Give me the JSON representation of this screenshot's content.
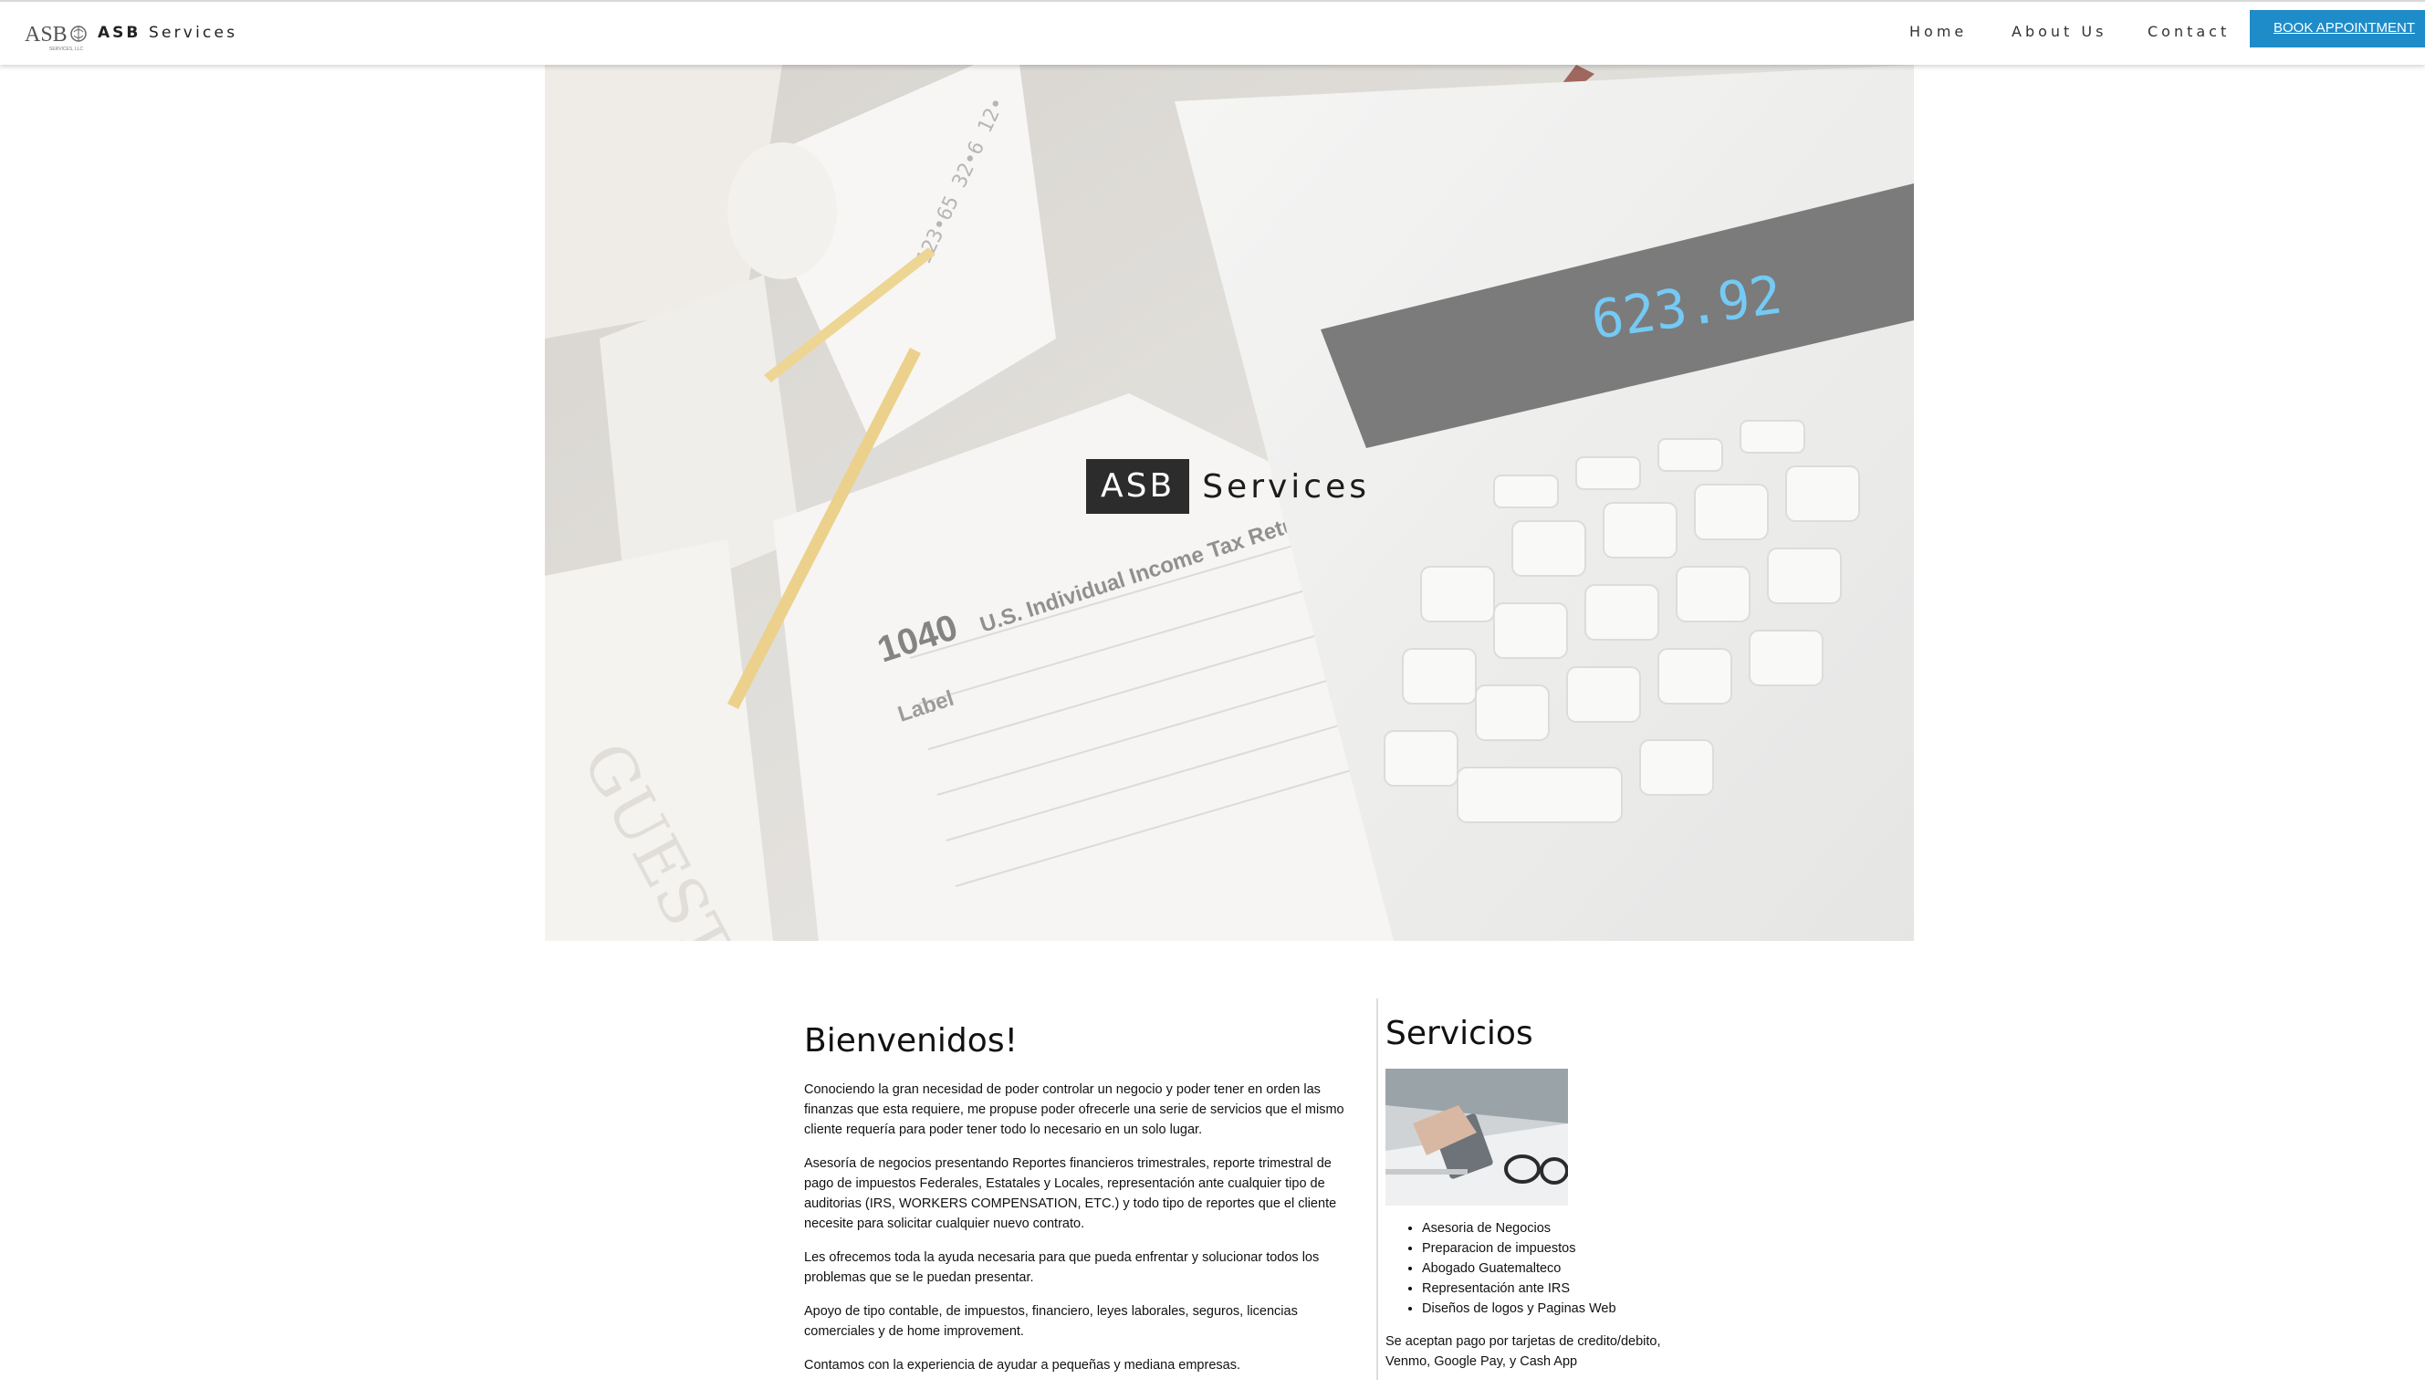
{
  "header": {
    "logo_text": "ASB",
    "logo_subtext": "SERVICES, LLC",
    "brand_bold": "ASB",
    "brand_rest": "Services",
    "nav": {
      "home": "Home",
      "about": "About Us",
      "contact": "Contact"
    },
    "book_button": "BOOK APPOINTMENT"
  },
  "hero": {
    "title_boxed": "ASB",
    "title_rest": "Services",
    "calculator_display": "623.92"
  },
  "welcome": {
    "title": "Bienvenidos!",
    "paragraphs": [
      "Conociendo la gran necesidad de poder controlar un negocio y poder tener en orden las finanzas que esta requiere, me propuse poder ofrecerle una serie de servicios que el mismo cliente requería para poder tener todo lo necesario en un solo lugar.",
      "Asesoría de negocios presentando Reportes financieros trimestrales, reporte trimestral de pago de impuestos Federales, Estatales y Locales, representación ante cualquier tipo de auditorias (IRS, WORKERS COMPENSATION, ETC.) y todo tipo de reportes que el cliente necesite para solicitar cualquier nuevo contrato.",
      "Les ofrecemos toda la ayuda necesaria para que pueda enfrentar y solucionar todos los problemas que se le puedan presentar.",
      "Apoyo de tipo contable, de impuestos, financiero, leyes laborales, seguros, licencias comerciales y de home improvement.",
      "Contamos con la experiencia de ayudar a pequeñas y mediana empresas."
    ]
  },
  "services": {
    "title": "Servicios",
    "items": [
      "Asesoria de Negocios",
      "Preparacion de impuestos",
      "Abogado Guatemalteco",
      "Representación ante IRS",
      "Diseños de logos y Paginas Web"
    ],
    "payment_note": "Se aceptan pago por tarjetas de credito/debito, Venmo, Google Pay, y Cash App"
  },
  "colors": {
    "accent": "#1e8cc9",
    "title_box": "#2c2c2c",
    "calculator_digits": "#3fb6f0"
  }
}
